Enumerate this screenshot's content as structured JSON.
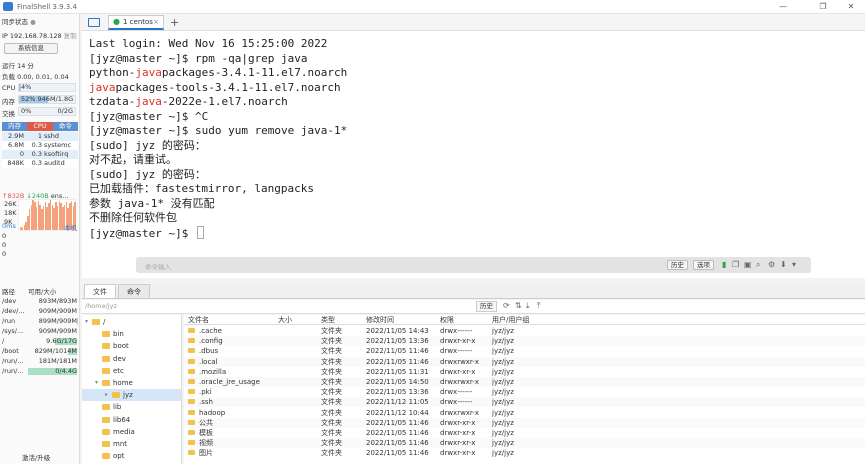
{
  "app": {
    "title": "FinalShell 3.9.3.4"
  },
  "window_controls": [
    "—",
    "❐",
    "✕"
  ],
  "sidebar": {
    "sync_status": "同步状态",
    "ip_label": "IP 192.168.78.128",
    "copy_label": "复制",
    "sysinfo_button": "系统信息",
    "uptime": "运行 14 分",
    "load": "负载 0.00, 0.01, 0.04",
    "cpu_label": "CPU",
    "cpu_value": "4%",
    "cpu_fraction": 0.04,
    "mem_label": "内存",
    "mem_value": "52%",
    "mem_detail": "946M/1.8G",
    "mem_fraction": 0.52,
    "swap_label": "交换",
    "swap_value": "0%",
    "swap_detail": "0/2G",
    "swap_fraction": 0.0,
    "proc_headers": [
      "内存",
      "CPU",
      "命令"
    ],
    "proc_header_colors": [
      "#5b8fd0",
      "#e05a4a",
      "#5b8fd0"
    ],
    "processes": [
      {
        "mem": "2.9M",
        "cpu": "1",
        "cmd": "sshd"
      },
      {
        "mem": "6.8M",
        "cpu": "0.3",
        "cmd": "systemc"
      },
      {
        "mem": "0",
        "cpu": "0.3",
        "cmd": "ksoftirq"
      },
      {
        "mem": "848K",
        "cpu": "0.3",
        "cmd": "auditd"
      }
    ],
    "net_up": "↑832B",
    "net_down": "↓240B",
    "net_iface": "ens...",
    "net_scale": [
      "26K",
      "18K",
      "9K"
    ],
    "latency_label": "0ms",
    "host_label": "本机",
    "latency_values": [
      "0",
      "0",
      "0"
    ],
    "disk_headers": [
      "路径",
      "可用/大小"
    ],
    "disks": [
      {
        "path": "/dev",
        "size": "893M/893M",
        "used": 0.0
      },
      {
        "path": "/dev/...",
        "size": "909M/909M",
        "used": 0.0
      },
      {
        "path": "/run",
        "size": "899M/909M",
        "used": 0.01
      },
      {
        "path": "/sys/...",
        "size": "909M/909M",
        "used": 0.0
      },
      {
        "path": "/",
        "size": "9.6G/17G",
        "used": 0.44
      },
      {
        "path": "/boot",
        "size": "829M/1014M",
        "used": 0.18
      },
      {
        "path": "/run/...",
        "size": "181M/181M",
        "used": 0.0
      },
      {
        "path": "/run/...",
        "size": "0/4.4G",
        "used": 1.0
      }
    ],
    "upgrade_label": "激活/升级"
  },
  "tabs": [
    {
      "label": "1 centos",
      "active": true
    }
  ],
  "terminal": {
    "lines": [
      [
        {
          "t": "Last login: Wed Nov 16 15:25:00 2022"
        }
      ],
      [
        {
          "t": "[jyz@master ~]$ rpm -qa|grep java"
        }
      ],
      [
        {
          "t": "python-"
        },
        {
          "t": "java",
          "red": true
        },
        {
          "t": "packages-3.4.1-11.el7.noarch"
        }
      ],
      [
        {
          "t": "java",
          "red": true
        },
        {
          "t": "packages-tools-3.4.1-11.el7.noarch"
        }
      ],
      [
        {
          "t": "tzdata-"
        },
        {
          "t": "java",
          "red": true
        },
        {
          "t": "-2022e-1.el7.noarch"
        }
      ],
      [
        {
          "t": "[jyz@master ~]$ ^C"
        }
      ],
      [
        {
          "t": "[jyz@master ~]$ sudo yum remove java-1*"
        }
      ],
      [
        {
          "t": "[sudo] jyz 的密码："
        }
      ],
      [
        {
          "t": "对不起，请重试。"
        }
      ],
      [
        {
          "t": "[sudo] jyz 的密码："
        }
      ],
      [
        {
          "t": "已加载插件：fastestmirror, langpacks"
        }
      ],
      [
        {
          "t": "参数 java-1* 没有匹配"
        }
      ],
      [
        {
          "t": "不删除任何软件包"
        }
      ],
      [
        {
          "t": "[jyz@master ~]$ "
        }
      ]
    ],
    "command_placeholder": "命令输入",
    "history_button": "历史",
    "options_button": "选项"
  },
  "bottom_tabs": [
    "文件",
    "命令"
  ],
  "file_path": "/home/jyz",
  "file_history_button": "历史",
  "tree": [
    {
      "label": "/",
      "depth": 0,
      "expanded": true
    },
    {
      "label": "bin",
      "depth": 1
    },
    {
      "label": "boot",
      "depth": 1
    },
    {
      "label": "dev",
      "depth": 1
    },
    {
      "label": "etc",
      "depth": 1
    },
    {
      "label": "home",
      "depth": 1,
      "expanded": true
    },
    {
      "label": "jyz",
      "depth": 2,
      "selected": true
    },
    {
      "label": "lib",
      "depth": 1
    },
    {
      "label": "lib64",
      "depth": 1
    },
    {
      "label": "media",
      "depth": 1
    },
    {
      "label": "mnt",
      "depth": 1
    },
    {
      "label": "opt",
      "depth": 1
    }
  ],
  "file_headers": [
    "文件名",
    "大小",
    "类型",
    "修改时间",
    "权限",
    "用户/用户组"
  ],
  "files": [
    {
      "name": ".cache",
      "size": "",
      "type": "文件夹",
      "mtime": "2022/11/05 14:43",
      "perm": "drwx------",
      "owner": "jyz/jyz"
    },
    {
      "name": ".config",
      "size": "",
      "type": "文件夹",
      "mtime": "2022/11/05 13:36",
      "perm": "drwxr-xr-x",
      "owner": "jyz/jyz"
    },
    {
      "name": ".dbus",
      "size": "",
      "type": "文件夹",
      "mtime": "2022/11/05 11:46",
      "perm": "drwx------",
      "owner": "jyz/jyz"
    },
    {
      "name": ".local",
      "size": "",
      "type": "文件夹",
      "mtime": "2022/11/05 11:46",
      "perm": "drwxrwxr-x",
      "owner": "jyz/jyz"
    },
    {
      "name": ".mozilla",
      "size": "",
      "type": "文件夹",
      "mtime": "2022/11/05 11:31",
      "perm": "drwxr-xr-x",
      "owner": "jyz/jyz"
    },
    {
      "name": ".oracle_jre_usage",
      "size": "",
      "type": "文件夹",
      "mtime": "2022/11/05 14:50",
      "perm": "drwxrwxr-x",
      "owner": "jyz/jyz"
    },
    {
      "name": ".pki",
      "size": "",
      "type": "文件夹",
      "mtime": "2022/11/05 13:36",
      "perm": "drwx------",
      "owner": "jyz/jyz"
    },
    {
      "name": ".ssh",
      "size": "",
      "type": "文件夹",
      "mtime": "2022/11/12 11:05",
      "perm": "drwx------",
      "owner": "jyz/jyz"
    },
    {
      "name": "hadoop",
      "size": "",
      "type": "文件夹",
      "mtime": "2022/11/12 10:44",
      "perm": "drwxrwxr-x",
      "owner": "jyz/jyz"
    },
    {
      "name": "公共",
      "size": "",
      "type": "文件夹",
      "mtime": "2022/11/05 11:46",
      "perm": "drwxr-xr-x",
      "owner": "jyz/jyz"
    },
    {
      "name": "模板",
      "size": "",
      "type": "文件夹",
      "mtime": "2022/11/05 11:46",
      "perm": "drwxr-xr-x",
      "owner": "jyz/jyz"
    },
    {
      "name": "视频",
      "size": "",
      "type": "文件夹",
      "mtime": "2022/11/05 11:46",
      "perm": "drwxr-xr-x",
      "owner": "jyz/jyz"
    },
    {
      "name": "图片",
      "size": "",
      "type": "文件夹",
      "mtime": "2022/11/05 11:46",
      "perm": "drwxr-xr-x",
      "owner": "jyz/jyz"
    }
  ],
  "net_chart": [
    3,
    2,
    4,
    7,
    12,
    18,
    22,
    26,
    24,
    20,
    25,
    22,
    18,
    21,
    24,
    20,
    23,
    26,
    22,
    19,
    24,
    21,
    25,
    23,
    20,
    22,
    24,
    19,
    23,
    25,
    21,
    24
  ]
}
